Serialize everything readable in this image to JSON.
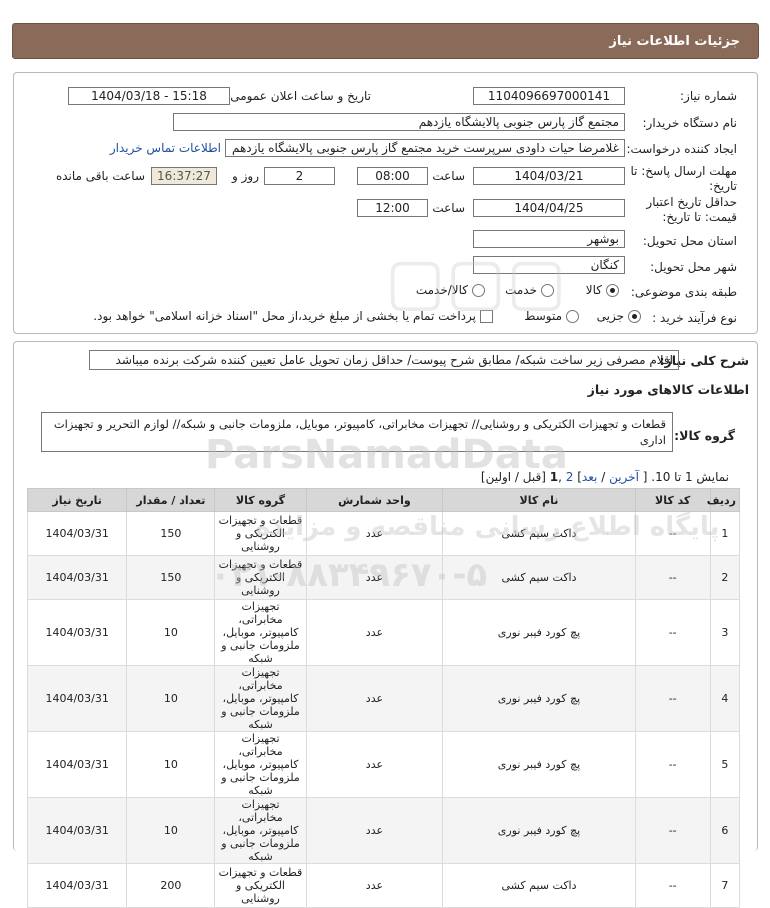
{
  "header": {
    "title": "جزئیات اطلاعات نیاز"
  },
  "form": {
    "need_number_label": "شماره نیاز:",
    "need_number": "1104096697000141",
    "announce_label": "تاریخ و ساعت اعلان عمومی:",
    "announce_value": "1404/03/18 - 15:18",
    "buyer_org_label": "نام دستگاه خریدار:",
    "buyer_org": "مجتمع گاز پارس جنوبی  پالایشگاه یازدهم",
    "requester_label": "ایجاد کننده درخواست:",
    "requester": "غلامرضا حیات داودی سرپرست خرید مجتمع گاز پارس جنوبی  پالایشگاه یازدهم",
    "buyer_contact_link": "اطلاعات تماس خریدار",
    "deadline_label_1": "مهلت ارسال پاسخ: تا",
    "deadline_label_2": "تاریخ:",
    "deadline_date": "1404/03/21",
    "time_label": "ساعت",
    "deadline_time": "08:00",
    "days_value": "2",
    "days_label": "روز و",
    "remaining_time": "16:37:27",
    "remaining_label": "ساعت باقی مانده",
    "validity_label_1": "حداقل تاریخ اعتبار",
    "validity_label_2": "قیمت: تا تاریخ:",
    "validity_date": "1404/04/25",
    "validity_time": "12:00",
    "province_label": "استان محل تحویل:",
    "province": "بوشهر",
    "city_label": "شهر محل تحویل:",
    "city": "کنگان",
    "category_label": "طبقه بندی موضوعی:",
    "category_options": [
      "کالا",
      "خدمت",
      "کالا/خدمت"
    ],
    "category_selected": "کالا",
    "process_label": "نوع فرآیند خرید :",
    "process_options": [
      "جزیی",
      "متوسط"
    ],
    "process_selected": "جزیی",
    "treasury_note": "پرداخت تمام یا بخشی از مبلغ خرید،از محل \"اسناد خزانه اسلامی\" خواهد بود."
  },
  "details": {
    "description_label": "شرح کلی نیاز:",
    "description": "اقلام مصرفی زیر ساخت شبکه/ مطابق شرح پیوست/ حداقل زمان تحویل عامل تعیین کننده شرکت برنده میباشد",
    "goods_info_title": "اطلاعات کالاهای مورد نیاز",
    "goods_group_label": "گروه کالا:",
    "goods_group": "قطعات و تجهیزات الکتریکی و روشنایی// تجهیزات مخابراتی، کامپیوتر، موبایل، ملزومات جانبی و شبکه// لوازم التحریر و تجهیزات اداری",
    "paging_prefix": "نمایش 1 تا 10. [",
    "paging_last": "آخرین",
    "paging_next": "بعد",
    "paging_page2": "2",
    "paging_page1": "1",
    "paging_suffix": "[قبل / اولین]"
  },
  "table": {
    "headers": [
      "ردیف",
      "کد کالا",
      "نام کالا",
      "واحد شمارش",
      "گروه کالا",
      "تعداد / مقدار",
      "تاریخ نیاز"
    ],
    "rows": [
      [
        "1",
        "--",
        "داکت سیم کشی",
        "عدد",
        "قطعات و تجهیزات الکتریکی و روشنایی",
        "150",
        "1404/03/31"
      ],
      [
        "2",
        "--",
        "داکت سیم کشی",
        "عدد",
        "قطعات و تجهیزات الکتریکی و روشنایی",
        "150",
        "1404/03/31"
      ],
      [
        "3",
        "--",
        "پچ کورد فیبر نوری",
        "عدد",
        "تجهیزات مخابراتی، کامپیوتر، موبایل، ملزومات جانبی و شبکه",
        "10",
        "1404/03/31"
      ],
      [
        "4",
        "--",
        "پچ کورد فیبر نوری",
        "عدد",
        "تجهیزات مخابراتی، کامپیوتر، موبایل، ملزومات جانبی و شبکه",
        "10",
        "1404/03/31"
      ],
      [
        "5",
        "--",
        "پچ کورد فیبر نوری",
        "عدد",
        "تجهیزات مخابراتی، کامپیوتر، موبایل، ملزومات جانبی و شبکه",
        "10",
        "1404/03/31"
      ],
      [
        "6",
        "--",
        "پچ کورد فیبر نوری",
        "عدد",
        "تجهیزات مخابراتی، کامپیوتر، موبایل، ملزومات جانبی و شبکه",
        "10",
        "1404/03/31"
      ],
      [
        "7",
        "--",
        "داکت سیم کشی",
        "عدد",
        "قطعات و تجهیزات الکتریکی و روشنایی",
        "200",
        "1404/03/31"
      ]
    ]
  },
  "watermark": {
    "brand": "ParsNamadData",
    "tagline": "پایگاه اطلاع رسانی مناقصه و مزایده",
    "phone": "۰۲۱-۸۸۳۴۹۶۷۰-۵"
  }
}
